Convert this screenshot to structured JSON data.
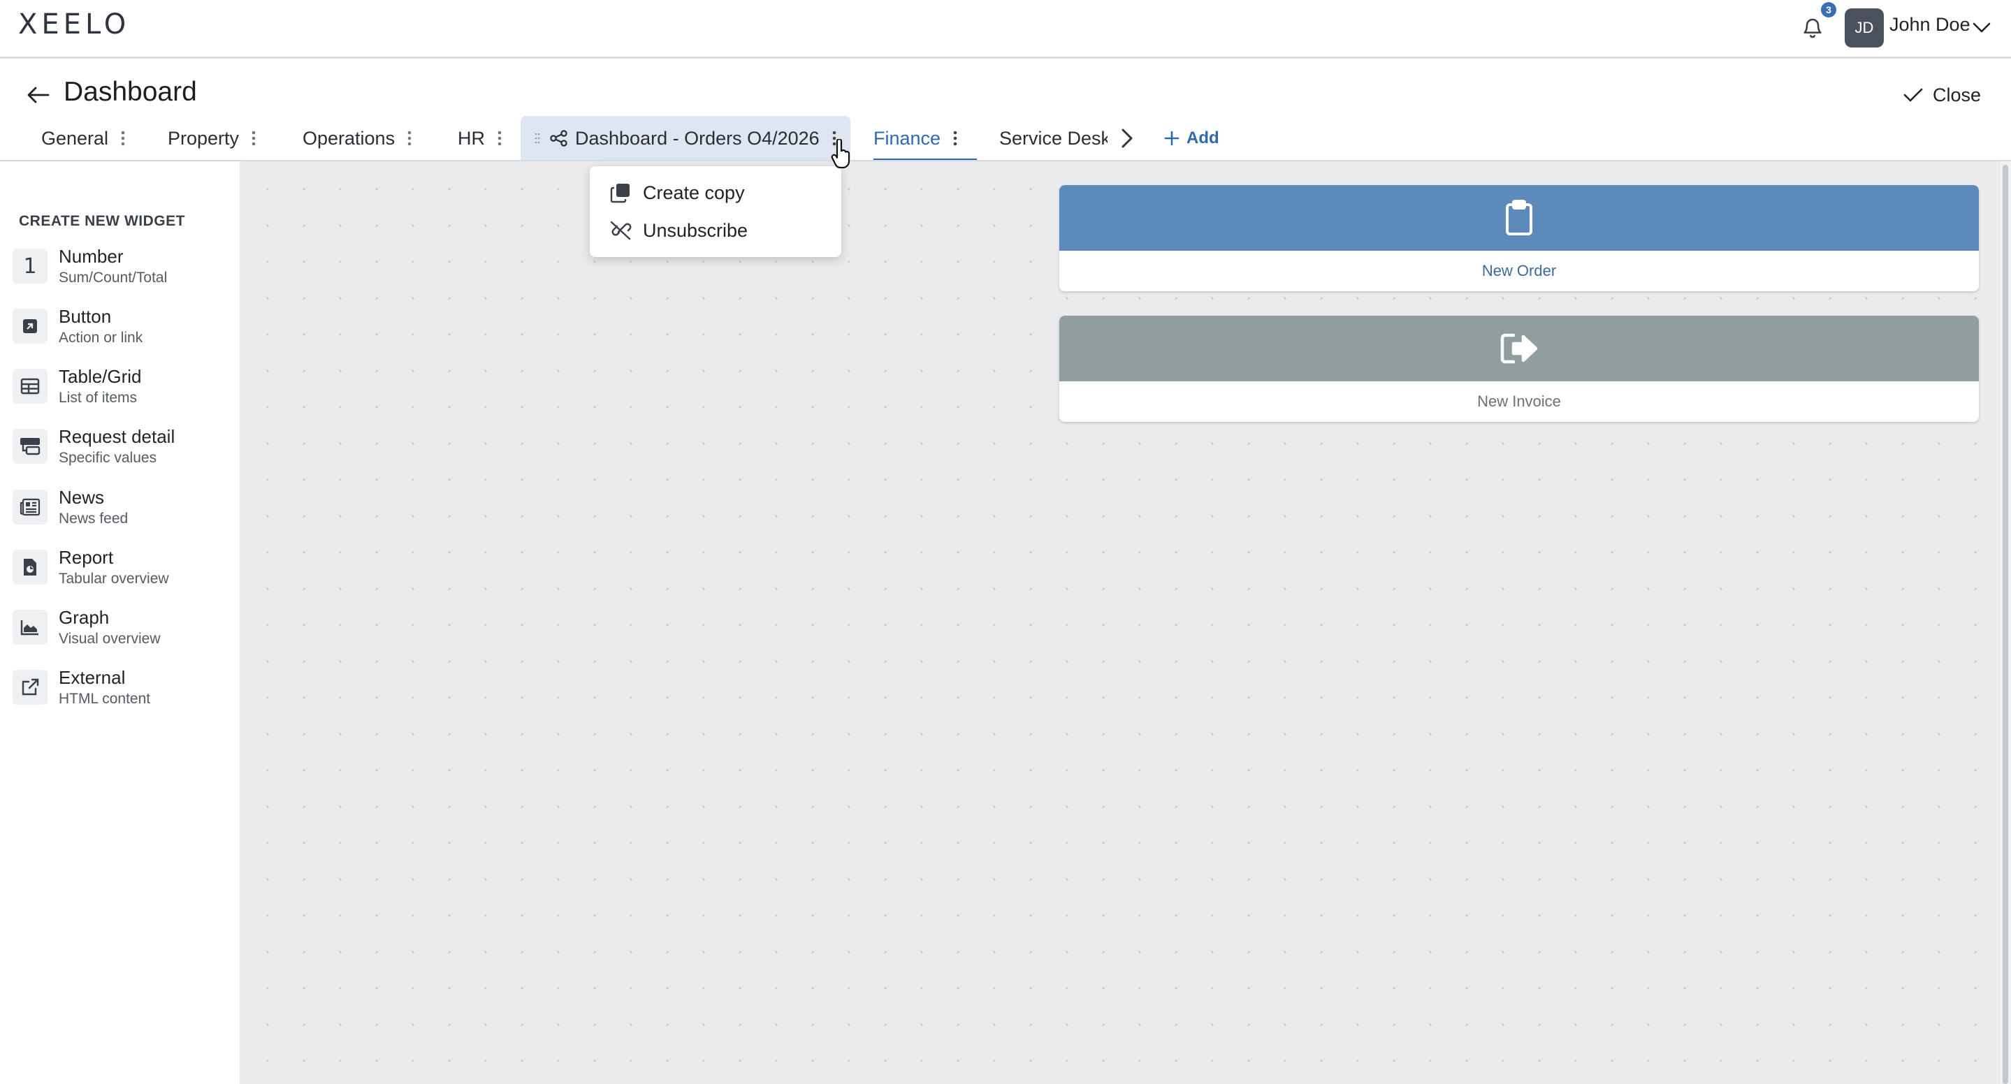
{
  "app": {
    "logo_text": "XEELO",
    "notifications": {
      "count": "3",
      "icon": "bell-icon"
    },
    "user": {
      "initials": "JD",
      "name": "John Doe"
    }
  },
  "header": {
    "title": "Dashboard",
    "close_label": "Close"
  },
  "tabs": [
    {
      "label": "General"
    },
    {
      "label": "Property"
    },
    {
      "label": "Operations"
    },
    {
      "label": "HR"
    },
    {
      "label": "Dashboard - Orders O4/2026",
      "state": "hovered-open"
    },
    {
      "label": "Finance",
      "state": "selected"
    },
    {
      "label": "Service Desk"
    }
  ],
  "add_tab_label": "Add",
  "tab_menu": {
    "items": [
      {
        "label": "Create copy",
        "icon": "copy-icon"
      },
      {
        "label": "Unsubscribe",
        "icon": "unlink-icon"
      }
    ]
  },
  "sidebar": {
    "heading": "CREATE NEW WIDGET",
    "widgets": [
      {
        "title": "Number",
        "subtitle": "Sum/Count/Total",
        "icon": "number-one-icon",
        "glyph": "1"
      },
      {
        "title": "Button",
        "subtitle": "Action or link",
        "icon": "button-icon"
      },
      {
        "title": "Table/Grid",
        "subtitle": "List of items",
        "icon": "table-icon"
      },
      {
        "title": "Request detail",
        "subtitle": "Specific values",
        "icon": "request-detail-icon"
      },
      {
        "title": "News",
        "subtitle": "News feed",
        "icon": "newspaper-icon"
      },
      {
        "title": "Report",
        "subtitle": "Tabular overview",
        "icon": "report-icon"
      },
      {
        "title": "Graph",
        "subtitle": "Visual overview",
        "icon": "area-chart-icon"
      },
      {
        "title": "External",
        "subtitle": "HTML content",
        "icon": "external-link-icon"
      }
    ]
  },
  "canvas_widgets": [
    {
      "label": "New Order",
      "icon": "clipboard-icon",
      "color": "#5b8abb",
      "label_color": "#3d6a9c"
    },
    {
      "label": "New Invoice",
      "icon": "sign-out-icon",
      "color": "#909e9f",
      "label_color": "#6b7272"
    }
  ],
  "colors": {
    "accent": "#2f68b1",
    "tab_active_bg": "#dde6f1",
    "canvas_bg": "#eaebed"
  }
}
